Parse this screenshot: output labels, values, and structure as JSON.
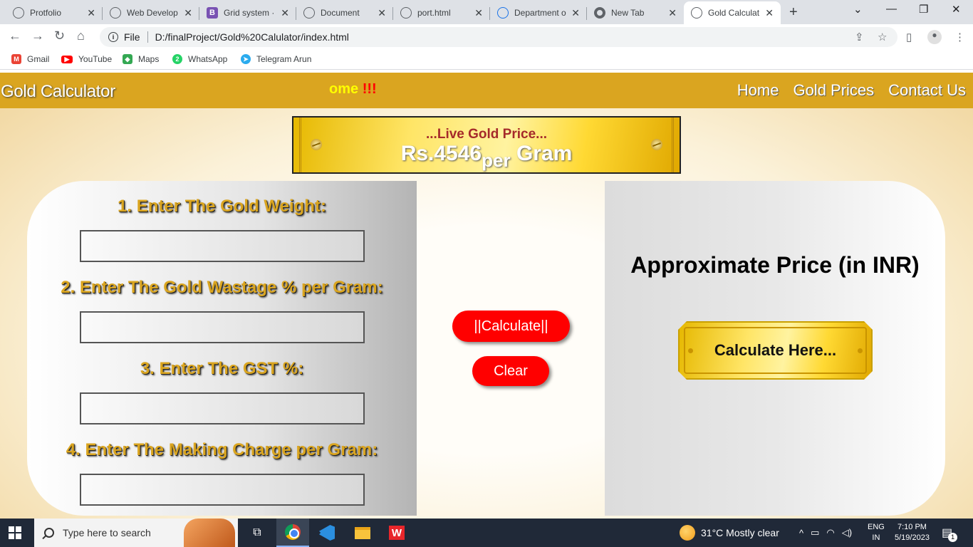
{
  "browser": {
    "tabs": [
      {
        "label": "Protfolio",
        "icon": "globe-icon",
        "active": false
      },
      {
        "label": "Web Develop",
        "icon": "globe-icon",
        "active": false
      },
      {
        "label": "Grid system ·",
        "icon": "bootstrap-icon",
        "active": false
      },
      {
        "label": "Document",
        "icon": "globe-icon",
        "active": false
      },
      {
        "label": "port.html",
        "icon": "globe-icon",
        "active": false
      },
      {
        "label": "Department o",
        "icon": "gear-globe-icon",
        "active": false
      },
      {
        "label": "New Tab",
        "icon": "chrome-icon",
        "active": false
      },
      {
        "label": "Gold Calculat",
        "icon": "globe-icon",
        "active": true
      }
    ],
    "address": {
      "scheme_label": "File",
      "url": "D:/finalProject/Gold%20Calulator/index.html"
    },
    "bookmarks": [
      {
        "label": "Gmail",
        "icon": "gmail-icon",
        "color": "#ea4335"
      },
      {
        "label": "YouTube",
        "icon": "youtube-icon",
        "color": "#ff0000"
      },
      {
        "label": "Maps",
        "icon": "maps-icon",
        "color": "#34a853"
      },
      {
        "label": "WhatsApp",
        "icon": "whatsapp-icon",
        "color": "#25d366"
      },
      {
        "label": "Telegram Arun",
        "icon": "telegram-icon",
        "color": "#2aabee"
      }
    ]
  },
  "site": {
    "brand": "Gold Calculator",
    "marquee_text": "ome",
    "marquee_exclaim": "!!!",
    "nav": [
      "Home",
      "Gold Prices",
      "Contact Us"
    ],
    "accent": "#daa520"
  },
  "price_plate": {
    "title": "...Live Gold Price...",
    "price": "Rs.4546",
    "per": "per",
    "unit": "Gram"
  },
  "form": {
    "questions": [
      {
        "label": "1. Enter The Gold Weight:",
        "value": ""
      },
      {
        "label": "2. Enter The Gold Wastage % per Gram:",
        "value": ""
      },
      {
        "label": "3. Enter The GST %:",
        "value": ""
      },
      {
        "label": "4. Enter The Making Charge per Gram:",
        "value": ""
      }
    ],
    "calculate_label": "||Calculate||",
    "clear_label": "Clear"
  },
  "result": {
    "heading": "Approximate Price (in INR)",
    "placeholder": "Calculate Here..."
  },
  "taskbar": {
    "search_placeholder": "Type here to search",
    "weather": "31°C  Mostly clear",
    "language": "ENG",
    "region": "IN",
    "time": "7:10 PM",
    "date": "5/19/2023",
    "notification_count": "1"
  }
}
